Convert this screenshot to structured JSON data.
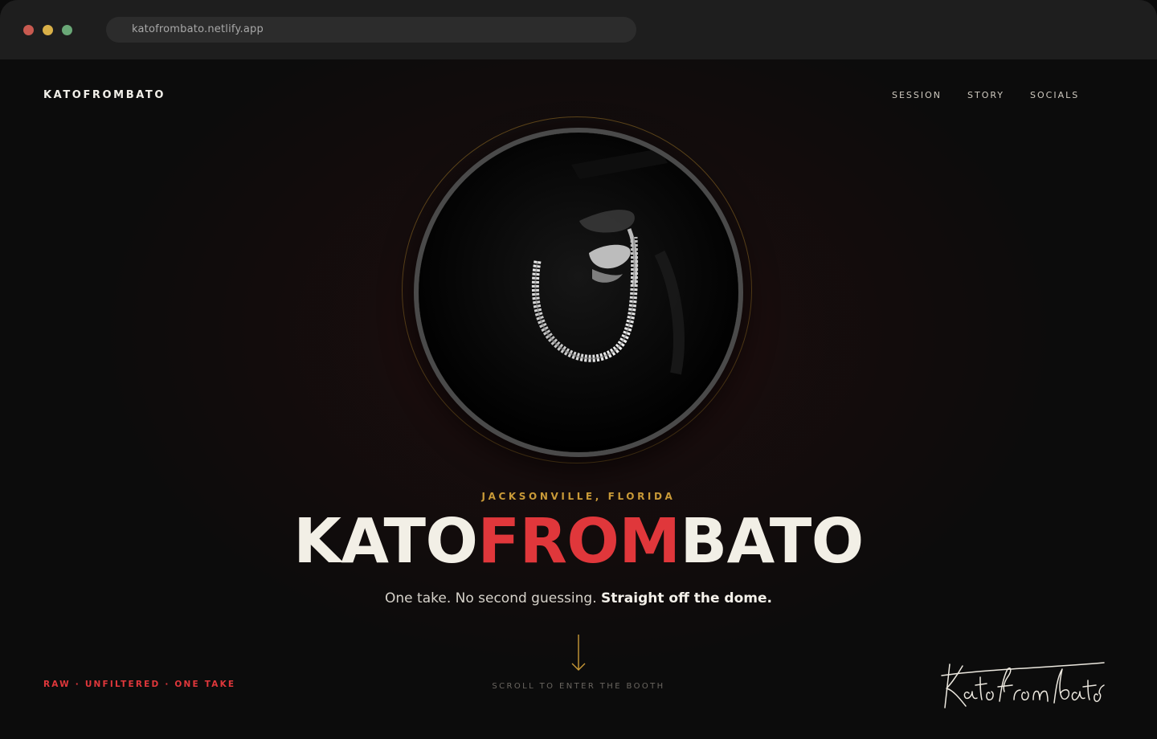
{
  "browser": {
    "url": "katofrombato.netlify.app",
    "traffic_light_colors": [
      "#c85a50",
      "#d9b048",
      "#6aa877"
    ]
  },
  "header": {
    "brand": "KATOFROMBATO",
    "nav": [
      {
        "label": "SESSION"
      },
      {
        "label": "STORY"
      },
      {
        "label": "SOCIALS"
      }
    ]
  },
  "hero": {
    "location": "JACKSONVILLE, FLORIDA",
    "title_part1": "KATO",
    "title_part2": "FROM",
    "title_part3": "BATO",
    "tagline_plain": "One take. No second guessing.",
    "tagline_bold": "Straight off the dome.",
    "scroll_hint": "SCROLL TO ENTER THE BOOTH",
    "bottom_left": "RAW · UNFILTERED · ONE TAKE",
    "signature_text": "Katofrombato"
  },
  "colors": {
    "accent_red": "#e0373b",
    "accent_gold": "#c99a38",
    "background": "#0c0c0c",
    "text_light": "#f2efe6"
  },
  "icons": {
    "scroll_arrow": "arrow-down-icon",
    "portrait": "portrait-photo"
  }
}
